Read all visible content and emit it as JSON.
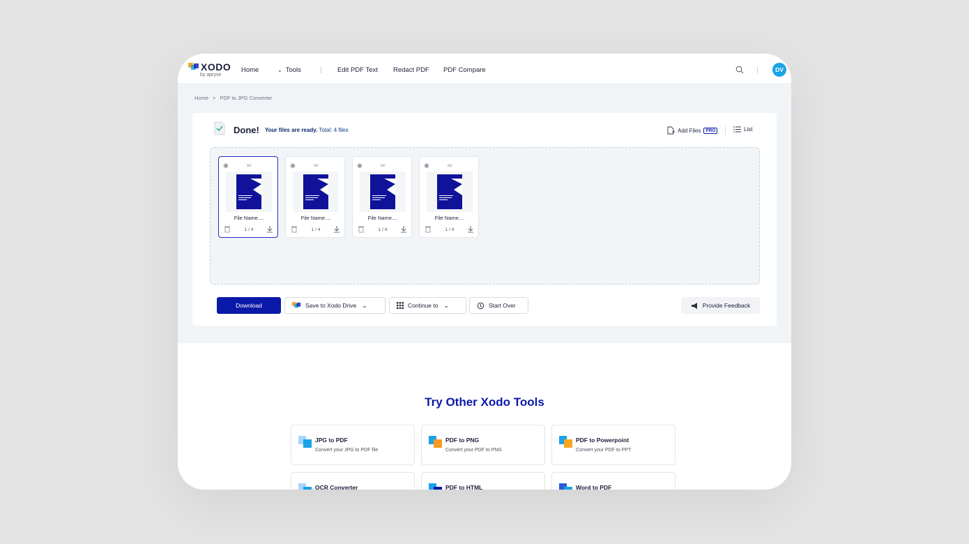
{
  "app": {
    "logo_text": "XODO",
    "logo_sub": "by apryse",
    "avatar": "DV"
  },
  "nav": {
    "home": "Home",
    "tools": "Tools",
    "edit_pdf_text": "Edit PDF Text",
    "redact_pdf": "Redact PDF",
    "pdf_compare": "PDF Compare"
  },
  "breadcrumb": {
    "home": "Home",
    "sep": ">",
    "current": "PDF to JPG Converter"
  },
  "status": {
    "title": "Done!",
    "ready": "Your files are ready.",
    "total": "Total: 4 files"
  },
  "toolbar": {
    "add_files": "Add Files",
    "pro_badge": "PRO",
    "list": "List"
  },
  "files": [
    {
      "name": "File Name....",
      "pages": "1 / 4",
      "selected": true
    },
    {
      "name": "File Name....",
      "pages": "1 / 4",
      "selected": false
    },
    {
      "name": "File Name....",
      "pages": "1 / 4",
      "selected": false
    },
    {
      "name": "File Name....",
      "pages": "1 / 4",
      "selected": false
    }
  ],
  "actions": {
    "download": "Download",
    "save_drive": "Save to Xodo Drive",
    "continue_to": "Continue to",
    "start_over": "Start Over",
    "feedback": "Provide Feedback"
  },
  "other_tools": {
    "title": "Try Other Xodo Tools",
    "items": [
      {
        "name": "JPG to PDF",
        "desc": "Convert your JPG to PDF file"
      },
      {
        "name": "PDF to PNG",
        "desc": "Convert your PDF to PNG"
      },
      {
        "name": "PDF to Powerpoint",
        "desc": "Convert your PDF to PPT"
      },
      {
        "name": "OCR Converter",
        "desc": ""
      },
      {
        "name": "PDF to HTML",
        "desc": ""
      },
      {
        "name": "Word to PDF",
        "desc": ""
      }
    ]
  },
  "colors": {
    "brand": "#0b19a8",
    "accent": "#1aa3e8",
    "background": "#f1f4f7"
  }
}
